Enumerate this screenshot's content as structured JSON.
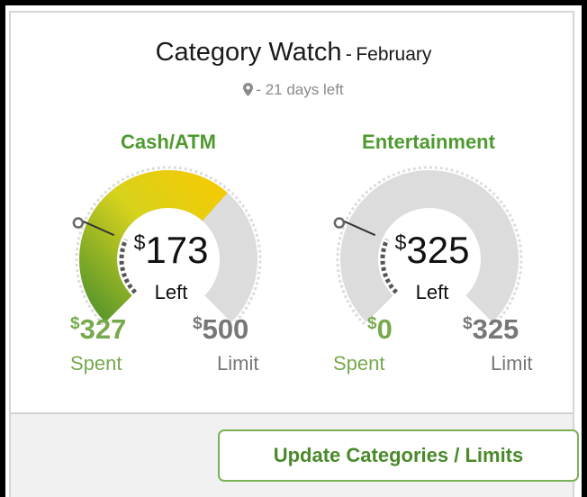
{
  "header": {
    "title": "Category Watch",
    "separator": "-",
    "month": "February",
    "days_left": "- 21 days left",
    "location_icon": "map-marker-icon"
  },
  "categories": [
    {
      "name": "Cash/ATM",
      "currency": "$",
      "left_amount": "173",
      "left_label": "Left",
      "spent_amount": "327",
      "spent_label": "Spent",
      "limit_amount": "500",
      "limit_label": "Limit",
      "spent_fraction": 0.654
    },
    {
      "name": "Entertainment",
      "currency": "$",
      "left_amount": "325",
      "left_label": "Left",
      "spent_amount": "0",
      "spent_label": "Spent",
      "limit_amount": "325",
      "limit_label": "Limit",
      "spent_fraction": 0
    }
  ],
  "footer": {
    "update_button_label": "Update Categories / Limits"
  },
  "colors": {
    "category_green": "#4e9a2f",
    "spent_green": "#77a94d",
    "gauge_track": "#dcdcdc",
    "gauge_fill_start": "#5f9a2a",
    "gauge_fill_mid": "#d6d21c",
    "gauge_fill_end": "#f2cb06",
    "button_border": "#79b256"
  }
}
